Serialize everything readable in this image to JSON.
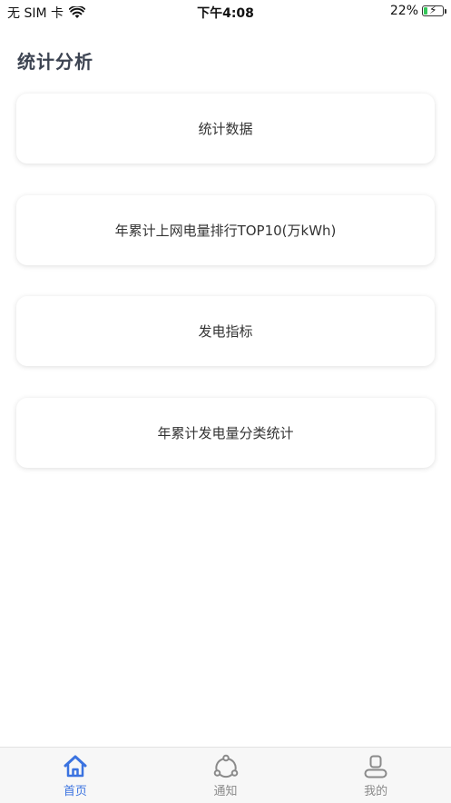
{
  "status_bar": {
    "carrier": "无 SIM 卡",
    "time": "下午4:08",
    "battery_percent": "22%",
    "battery_level": 0.22
  },
  "page": {
    "title": "统计分析"
  },
  "cards": [
    {
      "label": "统计数据"
    },
    {
      "label": "年累计上网电量排行TOP10(万kWh)"
    },
    {
      "label": "发电指标"
    },
    {
      "label": "年累计发电量分类统计"
    }
  ],
  "tab_bar": {
    "tabs": [
      {
        "label": "首页",
        "icon": "home-icon",
        "active": true
      },
      {
        "label": "通知",
        "icon": "share-icon",
        "active": false
      },
      {
        "label": "我的",
        "icon": "user-icon",
        "active": false
      }
    ]
  },
  "colors": {
    "accent": "#3b73e0",
    "inactive": "#8a8a8a",
    "title": "#3d4452"
  }
}
